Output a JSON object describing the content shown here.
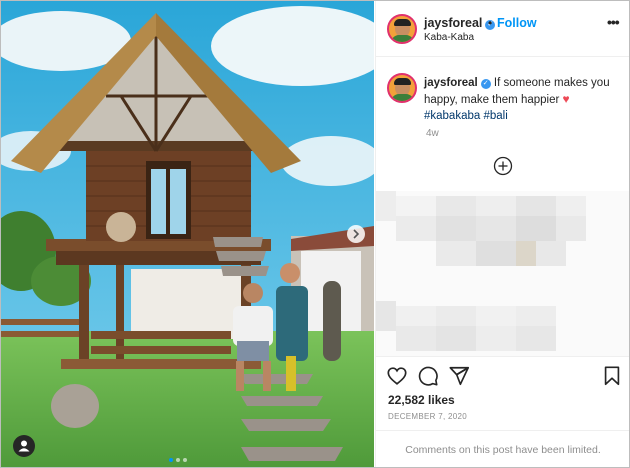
{
  "post": {
    "username": "jaysforeal",
    "verified_icon": "verified-badge-icon",
    "follow_label": "Follow",
    "separator": "•",
    "location": "Kaba-Kaba",
    "more_icon": "more-options-icon",
    "more_label": "•••"
  },
  "caption": {
    "username": "jaysforeal",
    "text": "If someone makes you happy, make them happier",
    "emoji": "♥",
    "hashtags": [
      "#kabakaba",
      "#bali"
    ],
    "age": "4w"
  },
  "load_more_icon": "plus-circle-icon",
  "actions": {
    "like_icon": "heart-outline-icon",
    "comment_icon": "comment-bubble-icon",
    "share_icon": "paper-plane-icon",
    "save_icon": "bookmark-icon"
  },
  "stats": {
    "likes": "22,582 likes",
    "date": "DECEMBER 7, 2020"
  },
  "comments_notice": "Comments on this post have been limited.",
  "carousel": {
    "slide_count": 3,
    "active_index": 0,
    "next_icon": "chevron-right-icon",
    "tag_icon": "user-tag-icon"
  },
  "colors": {
    "accent": "#0095f6",
    "heart": "#ed4956",
    "hashtag": "#00376b"
  }
}
